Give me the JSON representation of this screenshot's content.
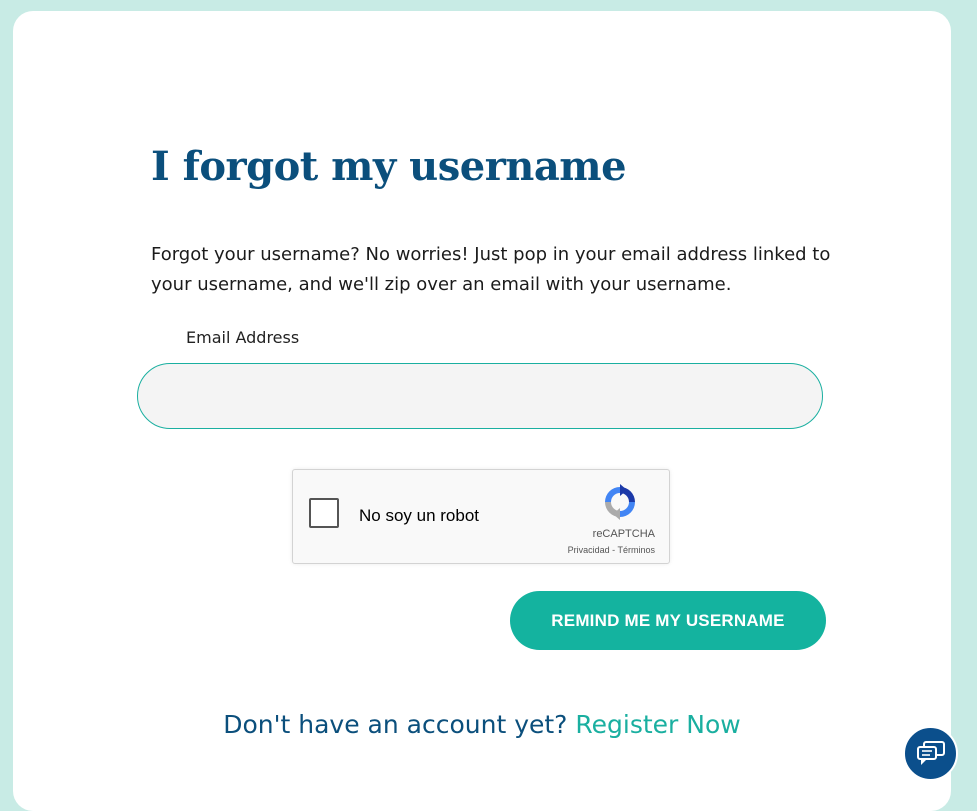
{
  "page": {
    "title": "I forgot my username",
    "description": "Forgot your username? No worries! Just pop in your email address linked to your username, and we'll zip over an email with your username."
  },
  "form": {
    "email_label": "Email Address",
    "email_value": "",
    "email_placeholder": "",
    "submit_label": "REMIND ME MY USERNAME"
  },
  "captcha": {
    "label": "No soy un robot",
    "brand": "reCAPTCHA",
    "links": "Privacidad - Términos",
    "checked": false
  },
  "footer": {
    "prompt": "Don't have an account yet?",
    "register_link": "Register Now"
  },
  "icons": {
    "chat": "chat-icon",
    "recaptcha": "recaptcha-logo-icon"
  },
  "colors": {
    "background": "#c8ebe5",
    "title": "#0b4f7c",
    "accent": "#14b39f",
    "chat_button": "#0b4f8c"
  }
}
